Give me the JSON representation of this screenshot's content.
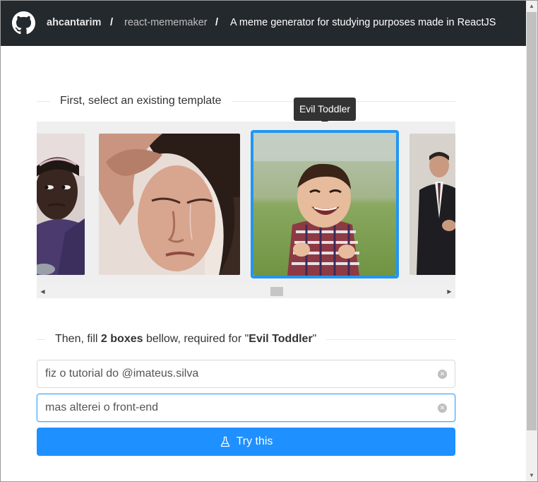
{
  "header": {
    "user": "ahcantarim",
    "separator": "/",
    "repo": "react-mememaker",
    "description": "A meme generator for studying purposes made in ReactJS"
  },
  "template_section": {
    "title": "First, select an existing template",
    "tooltip": "Evil Toddler",
    "selected_index": 2,
    "templates": [
      {
        "icon": "meme-photo-side-eye-girl"
      },
      {
        "icon": "meme-photo-crying-woman"
      },
      {
        "icon": "meme-photo-evil-toddler"
      },
      {
        "icon": "meme-photo-men-in-suits"
      }
    ]
  },
  "fill_section": {
    "prefix": "Then, fill ",
    "count_bold": "2 boxes",
    "middle": " bellow, required for \"",
    "template_bold": "Evil Toddler",
    "suffix": "\""
  },
  "boxes": [
    {
      "value": "fiz o tutorial do @imateus.silva"
    },
    {
      "value": "mas alterei o front-end"
    }
  ],
  "actions": {
    "try_label": "Try this"
  },
  "colors": {
    "topbar": "#24292e",
    "accent": "#1e90ff",
    "selected_border": "#2196f3"
  }
}
